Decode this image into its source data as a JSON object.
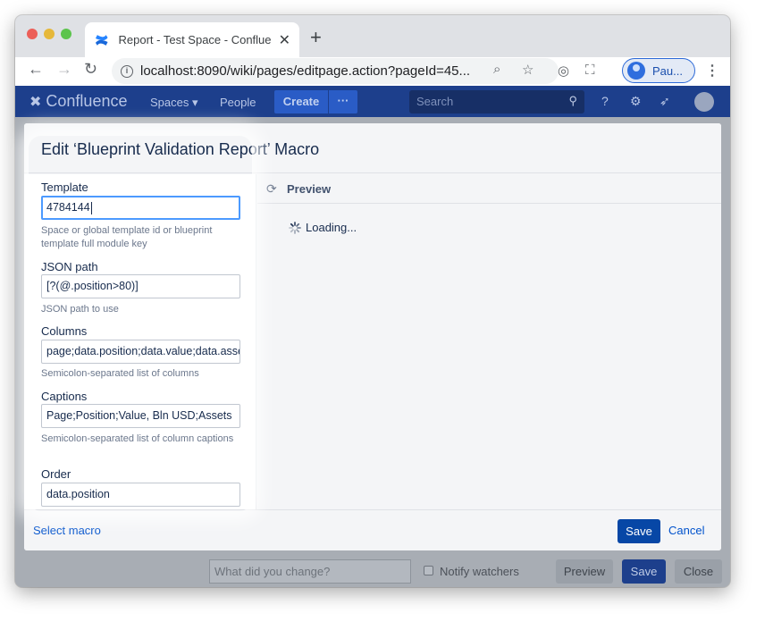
{
  "browser": {
    "tab_title": "Report - Test Space - Confluence",
    "tab_close": "✕",
    "new_tab": "+",
    "url": "localhost:8090/wiki/pages/editpage.action?pageId=45...",
    "profile_name": "Pau..."
  },
  "confluence": {
    "logo_text": "Confluence",
    "nav": {
      "spaces": "Spaces",
      "people": "People",
      "create": "Create",
      "more": "···"
    },
    "search_placeholder": "Search"
  },
  "dialog": {
    "title": "Edit ‘Blueprint Validation Report’ Macro",
    "fields": [
      {
        "label": "Template",
        "value": "4784144",
        "help": "Space or global template id or blueprint template full module key"
      },
      {
        "label": "JSON path",
        "value": "[?(@.position>80)]",
        "help": "JSON path to use"
      },
      {
        "label": "Columns",
        "value": "page;data.position;data.value;data.assets",
        "help": "Semicolon-separated list of columns"
      },
      {
        "label": "Captions",
        "value": "Page;Position;Value, Bln USD;Assets",
        "help": "Semicolon-separated list of column captions"
      },
      {
        "label": "Order",
        "value": "data.position",
        "help": ""
      }
    ],
    "preview_label": "Preview",
    "loading_text": "Loading...",
    "footer": {
      "select_macro": "Select macro",
      "save": "Save",
      "cancel": "Cancel"
    }
  },
  "page_footer": {
    "change_placeholder": "What did you change?",
    "notify_label": "Notify watchers",
    "preview": "Preview",
    "save": "Save",
    "close": "Close"
  }
}
